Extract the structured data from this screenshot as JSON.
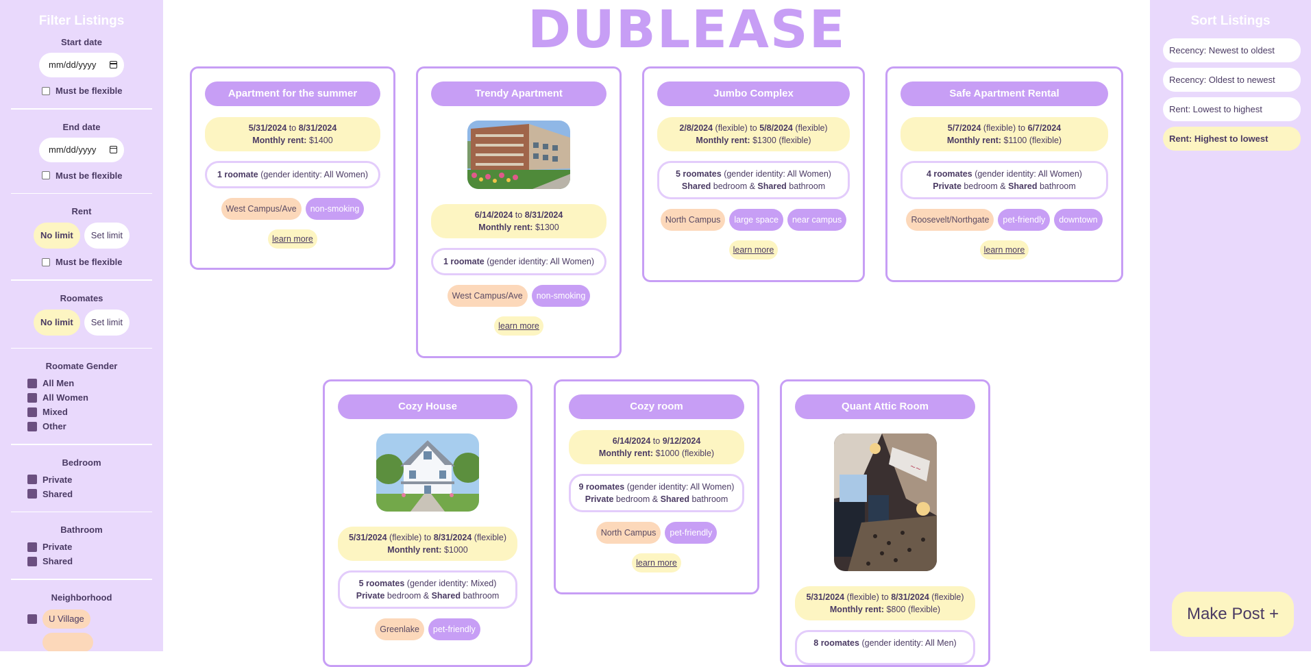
{
  "app": {
    "logo": "DUBLEASE"
  },
  "filters": {
    "title": "Filter Listings",
    "start_date": {
      "label": "Start date",
      "placeholder": "mm/dd/yyyy",
      "flex_label": "Must be flexible"
    },
    "end_date": {
      "label": "End date",
      "placeholder": "mm/dd/yyyy",
      "flex_label": "Must be flexible"
    },
    "rent": {
      "label": "Rent",
      "no_limit": "No limit",
      "set_limit": "Set limit",
      "flex_label": "Must be flexible"
    },
    "roommates": {
      "label": "Roomates",
      "no_limit": "No limit",
      "set_limit": "Set limit"
    },
    "gender": {
      "label": "Roomate Gender",
      "options": [
        "All Men",
        "All Women",
        "Mixed",
        "Other"
      ]
    },
    "bedroom": {
      "label": "Bedroom",
      "options": [
        "Private",
        "Shared"
      ]
    },
    "bathroom": {
      "label": "Bathroom",
      "options": [
        "Private",
        "Shared"
      ]
    },
    "neighborhood": {
      "label": "Neighborhood",
      "options": [
        "U Village"
      ]
    }
  },
  "sort": {
    "title": "Sort Listings",
    "options": [
      "Recency: Newest to oldest",
      "Recency: Oldest to newest",
      "Rent: Lowest to highest",
      "Rent: Highest to lowest"
    ],
    "active": "Rent: Highest to lowest"
  },
  "make_post": "Make Post +",
  "listings": [
    {
      "title": "Apartment for the summer",
      "start": "5/31/2024",
      "start_flex": "",
      "to": "to",
      "end": "8/31/2024",
      "end_flex": "",
      "rent_label": "Monthly rent:",
      "rent": "$1400",
      "rent_flex": "",
      "roommates": "1 roomate",
      "gender": "(gender identity: All Women)",
      "bedroom": "",
      "bathroom": "",
      "tags": [
        {
          "text": "West Campus/Ave",
          "kind": "orange"
        },
        {
          "text": "non-smoking",
          "kind": "purple"
        }
      ],
      "learn": "learn more",
      "photo": ""
    },
    {
      "title": "Trendy Apartment",
      "start": "6/14/2024",
      "start_flex": "",
      "to": "to",
      "end": "8/31/2024",
      "end_flex": "",
      "rent_label": "Monthly rent:",
      "rent": "$1300",
      "rent_flex": "",
      "roommates": "1 roomate",
      "gender": "(gender identity: All Women)",
      "bedroom": "",
      "bathroom": "",
      "tags": [
        {
          "text": "West Campus/Ave",
          "kind": "orange"
        },
        {
          "text": "non-smoking",
          "kind": "purple"
        }
      ],
      "learn": "learn more",
      "photo": "apartment-building"
    },
    {
      "title": "Jumbo Complex",
      "start": "2/8/2024",
      "start_flex": "(flexible)",
      "to": "to",
      "end": "5/8/2024",
      "end_flex": "(flexible)",
      "rent_label": "Monthly rent:",
      "rent": "$1300",
      "rent_flex": "(flexible)",
      "roommates": "5 roomates",
      "gender": "(gender identity: All Women)",
      "bedroom": "Shared",
      "bathroom": "Shared",
      "tags": [
        {
          "text": "North Campus",
          "kind": "orange"
        },
        {
          "text": "large space",
          "kind": "purple"
        },
        {
          "text": "near campus",
          "kind": "purple"
        }
      ],
      "learn": "learn more",
      "photo": ""
    },
    {
      "title": "Safe Apartment Rental",
      "start": "5/7/2024",
      "start_flex": "(flexible)",
      "to": "to",
      "end": "6/7/2024",
      "end_flex": "",
      "rent_label": "Monthly rent:",
      "rent": "$1100",
      "rent_flex": "(flexible)",
      "roommates": "4 roomates",
      "gender": "(gender identity: All Women)",
      "bedroom": "Private",
      "bathroom": "Shared",
      "tags": [
        {
          "text": "Roosevelt/Northgate",
          "kind": "orange"
        },
        {
          "text": "pet-friendly",
          "kind": "purple"
        },
        {
          "text": "downtown",
          "kind": "purple"
        }
      ],
      "learn": "learn more",
      "photo": ""
    },
    {
      "title": "Cozy House",
      "start": "5/31/2024",
      "start_flex": "(flexible)",
      "to": "to",
      "end": "8/31/2024",
      "end_flex": "(flexible)",
      "rent_label": "Monthly rent:",
      "rent": "$1000",
      "rent_flex": "",
      "roommates": "5 roomates",
      "gender": "(gender identity: Mixed)",
      "bedroom": "Private",
      "bathroom": "Shared",
      "tags": [
        {
          "text": "Greenlake",
          "kind": "orange"
        },
        {
          "text": "pet-friendly",
          "kind": "purple"
        }
      ],
      "learn": "learn more",
      "photo": "white-house"
    },
    {
      "title": "Cozy room",
      "start": "6/14/2024",
      "start_flex": "",
      "to": "to",
      "end": "9/12/2024",
      "end_flex": "",
      "rent_label": "Monthly rent:",
      "rent": "$1000",
      "rent_flex": "(flexible)",
      "roommates": "9 roomates",
      "gender": "(gender identity: All Women)",
      "bedroom": "Private",
      "bathroom": "Shared",
      "tags": [
        {
          "text": "North Campus",
          "kind": "orange"
        },
        {
          "text": "pet-friendly",
          "kind": "purple"
        }
      ],
      "learn": "learn more",
      "photo": ""
    },
    {
      "title": "Quant Attic Room",
      "start": "5/31/2024",
      "start_flex": "(flexible)",
      "to": "to",
      "end": "8/31/2024",
      "end_flex": "(flexible)",
      "rent_label": "Monthly rent:",
      "rent": "$800",
      "rent_flex": "(flexible)",
      "roommates": "8 roomates",
      "gender": "(gender identity: All Men)",
      "bedroom": "",
      "bathroom": "",
      "tags": [],
      "learn": "",
      "photo": "attic-room"
    }
  ],
  "words": {
    "bedroom": "bedroom",
    "bathroom": "bathroom",
    "amp": "&"
  }
}
